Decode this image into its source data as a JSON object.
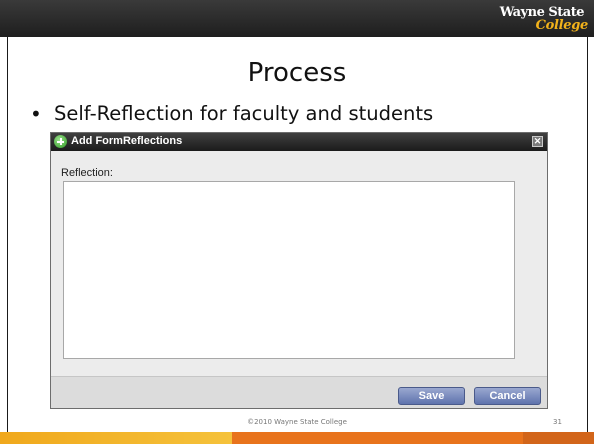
{
  "slide": {
    "logo_line1": "Wayne State",
    "logo_line2": "College",
    "title": "Process",
    "bullet": "Self-Reflection for faculty and students",
    "footer_text": "©2010 Wayne State College",
    "page_number": "31"
  },
  "dialog": {
    "title": "Add FormReflections",
    "close_glyph": "✕",
    "field_label": "Reflection:",
    "reflection_value": "",
    "save_label": "Save",
    "cancel_label": "Cancel"
  },
  "colors": {
    "top_bar": "#2a2a2a",
    "accent_gold": "#f2b21b",
    "accent_orange": "#e8731c",
    "button_blue": "#6f82b9"
  }
}
